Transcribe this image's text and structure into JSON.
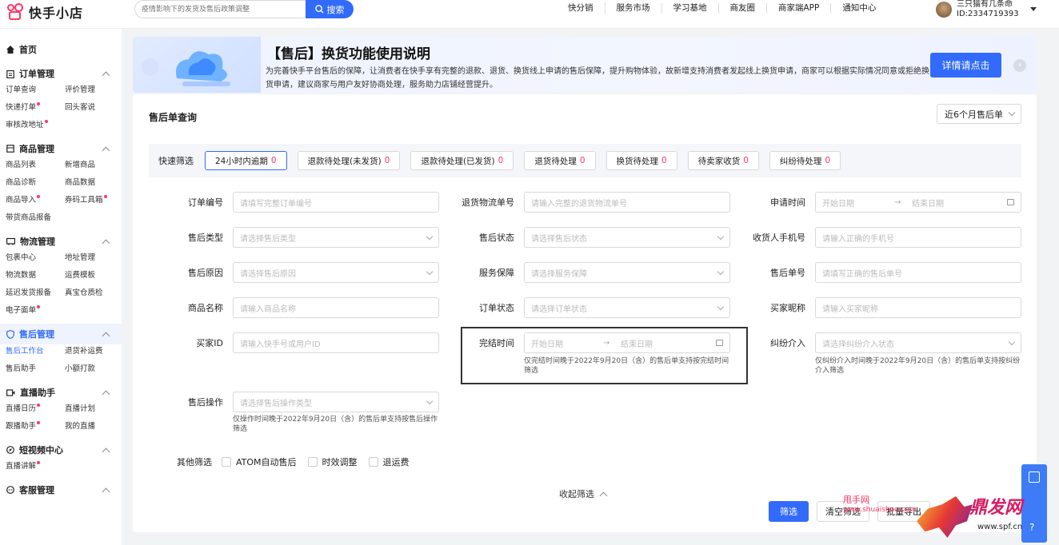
{
  "app": {
    "name": "快手小店"
  },
  "search": {
    "placeholder": "疫情影响下的发货及售后政策调整",
    "button": "搜索"
  },
  "topnav": [
    "快分销",
    "服务市场",
    "学习基地",
    "商友圈",
    "商家端APP",
    "通知中心"
  ],
  "user": {
    "name": "三只猫有几条命",
    "id": "ID:2334719393"
  },
  "sidebar": {
    "home": "首页",
    "groups": [
      {
        "title": "订单管理",
        "items": [
          {
            "label": "订单查询",
            "dot": false
          },
          {
            "label": "评价管理",
            "dot": false
          },
          {
            "label": "快递打单",
            "dot": true
          },
          {
            "label": "回头客说",
            "dot": false
          },
          {
            "label": "审核改地址",
            "dot": true
          }
        ]
      },
      {
        "title": "商品管理",
        "items": [
          {
            "label": "商品列表",
            "dot": false
          },
          {
            "label": "新增商品",
            "dot": false
          },
          {
            "label": "商品诊断",
            "dot": false
          },
          {
            "label": "商品数据",
            "dot": false
          },
          {
            "label": "商品导入",
            "dot": true
          },
          {
            "label": "券码工具箱",
            "dot": true
          },
          {
            "label": "带货商品报备",
            "dot": false
          }
        ]
      },
      {
        "title": "物流管理",
        "items": [
          {
            "label": "包裹中心",
            "dot": false
          },
          {
            "label": "地址管理",
            "dot": false
          },
          {
            "label": "物流数据",
            "dot": false
          },
          {
            "label": "运费模板",
            "dot": false
          },
          {
            "label": "延迟发货报备",
            "dot": false
          },
          {
            "label": "真宝仓质检",
            "dot": false
          },
          {
            "label": "电子面单",
            "dot": true
          }
        ]
      },
      {
        "title": "售后管理",
        "active": true,
        "items": [
          {
            "label": "售后工作台",
            "dot": false,
            "active": true
          },
          {
            "label": "退货补运费",
            "dot": false
          },
          {
            "label": "售后助手",
            "dot": false
          },
          {
            "label": "小额打款",
            "dot": false
          }
        ]
      },
      {
        "title": "直播助手",
        "items": [
          {
            "label": "直播日历",
            "dot": true
          },
          {
            "label": "直播计划",
            "dot": false
          },
          {
            "label": "跟播助手",
            "dot": true
          },
          {
            "label": "我的直播",
            "dot": false
          }
        ]
      },
      {
        "title": "短视频中心",
        "items": [
          {
            "label": "直播讲解",
            "dot": true
          }
        ]
      },
      {
        "title": "客服管理",
        "items": []
      }
    ]
  },
  "banner": {
    "title": "【售后】换货功能使用说明",
    "desc": "为完善快手平台售后的保障，让消费者在快手享有完整的退款、退货、换货线上申请的售后保障，提升购物体验，故新增支持消费者发起线上换货申请，商家可以根据实际情况同意或拒绝换货申请，建议商家与用户友好协商处理，服务助力店铺经营提升。",
    "button": "详情请点击"
  },
  "main": {
    "title": "售后单查询",
    "range": "近6个月售后单",
    "quick_label": "快速筛选",
    "quick": [
      {
        "label": "24小时内逾期",
        "count": "0"
      },
      {
        "label": "退款待处理(未发货)",
        "count": "0"
      },
      {
        "label": "退款待处理(已发货)",
        "count": "0"
      },
      {
        "label": "退货待处理",
        "count": "0"
      },
      {
        "label": "换货待处理",
        "count": "0"
      },
      {
        "label": "待卖家收货",
        "count": "0"
      },
      {
        "label": "纠纷待处理",
        "count": "0"
      }
    ],
    "fields": {
      "order_no": {
        "label": "订单编号",
        "placeholder": "请填写完整订单编号"
      },
      "return_no": {
        "label": "退货物流单号",
        "placeholder": "请输入完整的退货物流单号"
      },
      "apply_time": {
        "label": "申请时间",
        "start": "开始日期",
        "end": "结束日期"
      },
      "type": {
        "label": "售后类型",
        "placeholder": "请选择售后类型"
      },
      "status": {
        "label": "售后状态",
        "placeholder": "请选择售后状态"
      },
      "phone": {
        "label": "收货人手机号",
        "placeholder": "请输入正确的手机号"
      },
      "reason": {
        "label": "售后原因",
        "placeholder": "请选择售后原因"
      },
      "guarantee": {
        "label": "服务保障",
        "placeholder": "请选择服务保障"
      },
      "aftersale_no": {
        "label": "售后单号",
        "placeholder": "请填写正确的售后单号"
      },
      "product": {
        "label": "商品名称",
        "placeholder": "请输入商品名称"
      },
      "order_status": {
        "label": "订单状态",
        "placeholder": "请选择订单状态"
      },
      "nickname": {
        "label": "买家昵称",
        "placeholder": "请输入买家昵称"
      },
      "buyer_id": {
        "label": "买家ID",
        "placeholder": "请输入快手号或用户ID"
      },
      "finish_time": {
        "label": "完结时间",
        "start": "开始日期",
        "end": "结束日期",
        "note": "仅完结时间晚于2022年9月20日（含）的售后单支持按完结时间筛选"
      },
      "dispute": {
        "label": "纠纷介入",
        "placeholder": "请选择纠纷介入状态",
        "note": "仅纠纷介入时间晚于2022年9月20日（含）的售后单支持按纠纷介入筛选"
      },
      "operation": {
        "label": "售后操作",
        "placeholder": "请选择售后操作类型",
        "note": "仅操作时间晚于2022年9月20日（含）的售后单支持按售后操作筛选"
      }
    },
    "other_label": "其他筛选",
    "checkboxes": [
      "ATOM自动售后",
      "时效调整",
      "退运费"
    ],
    "collapse": "收起筛选",
    "actions": {
      "filter": "筛选",
      "clear": "清空筛选",
      "export": "批量导出"
    }
  },
  "watermark": {
    "line1": "甩手网",
    "line2": "www.shuaishou.com",
    "brand": "鼎发网",
    "site": "www.spf.cn"
  }
}
